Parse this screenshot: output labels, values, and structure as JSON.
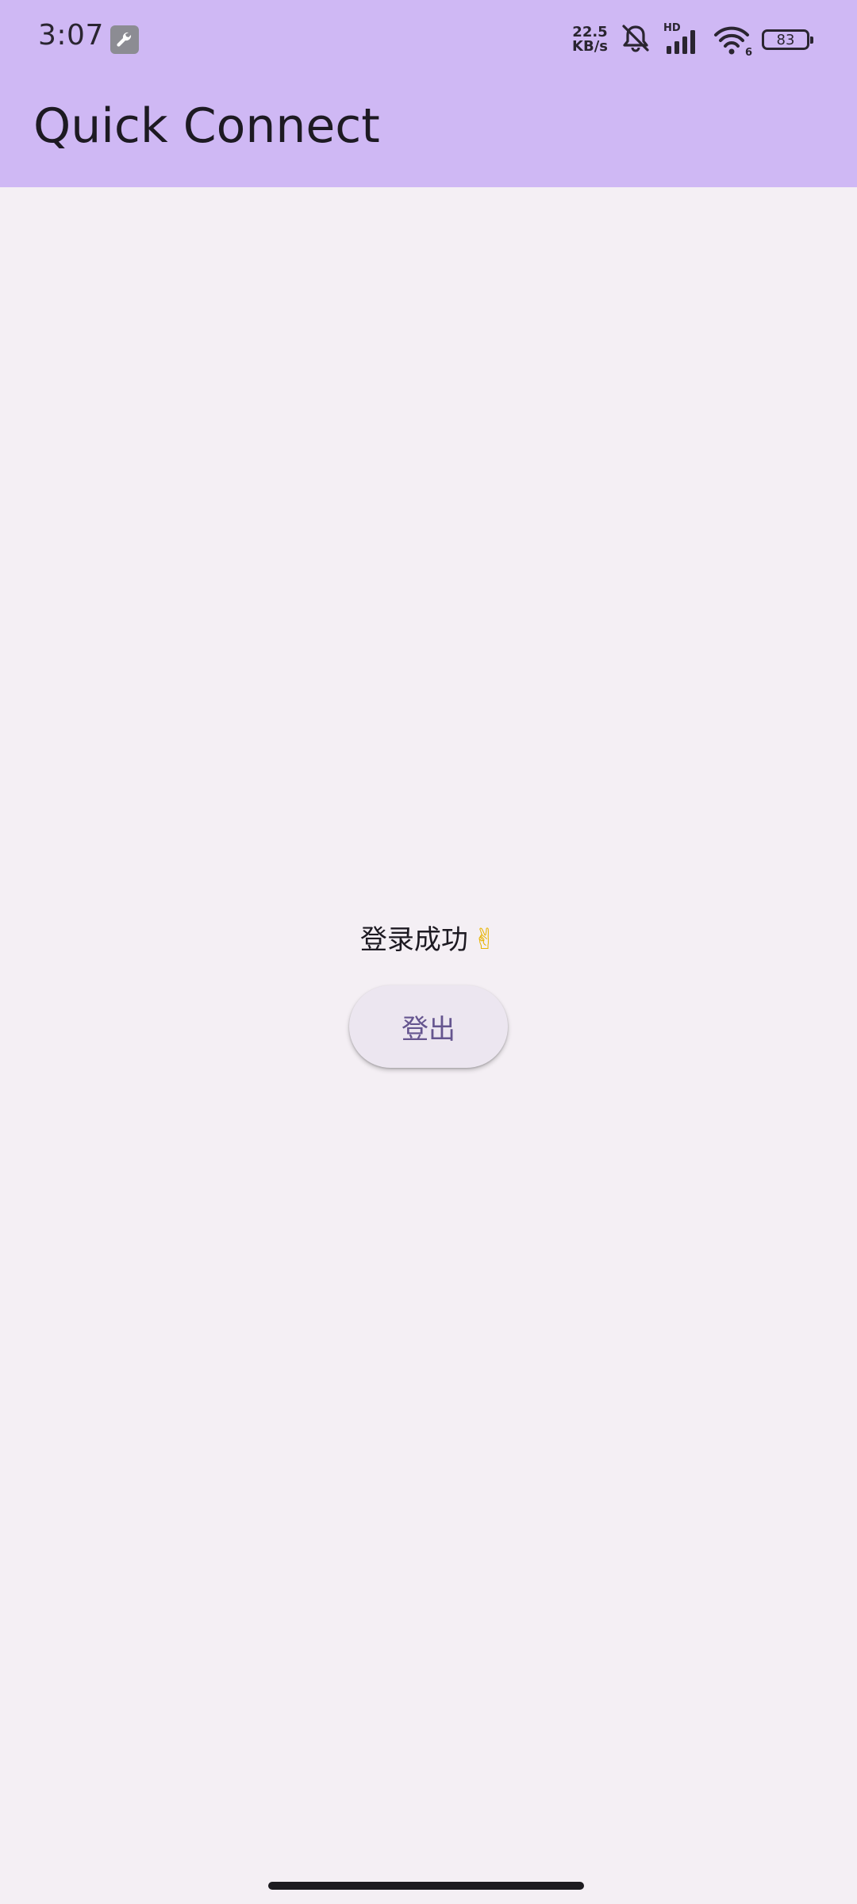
{
  "status_bar": {
    "time": "3:07",
    "net_speed_value": "22.5",
    "net_speed_unit": "KB/s",
    "network_label": "HD",
    "wifi_label": "6",
    "battery": "83"
  },
  "app_bar": {
    "title": "Quick Connect",
    "color": "#cfb8f4"
  },
  "main": {
    "message": "登录成功",
    "message_emoji": "✌",
    "logout_label": "登出",
    "accent": "#65558f"
  }
}
